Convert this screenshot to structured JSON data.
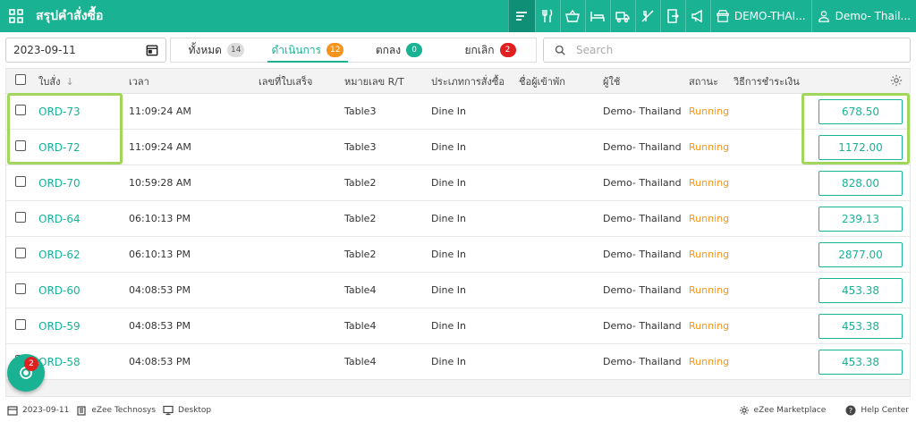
{
  "header": {
    "title": "สรุปคำสั่งซื้อ",
    "outlet": "DEMO-THAI...",
    "user": "Demo- Thail..."
  },
  "filters": {
    "date": "2023-09-11",
    "tabs": [
      {
        "label": "ทั้งหมด",
        "count": "14"
      },
      {
        "label": "ดำเนินการ",
        "count": "12"
      },
      {
        "label": "ตกลง",
        "count": "0"
      },
      {
        "label": "ยกเลิก",
        "count": "2"
      }
    ],
    "search_placeholder": "Search"
  },
  "table": {
    "columns": {
      "order": "ใบสั่ง",
      "time": "เวลา",
      "receipt": "เลขที่ใบเสร็จ",
      "table_no": "หมายเลข R/T",
      "order_type": "ประเภทการสั่งซื้อ",
      "guest": "ชื่อผู้เข้าพัก",
      "user": "ผู้ใช้",
      "status": "สถานะ",
      "payment": "วิธีการชำระเงิน"
    },
    "rows": [
      {
        "order": "ORD-73",
        "time": "11:09:24 AM",
        "table": "Table3",
        "type": "Dine In",
        "user": "Demo- Thailand",
        "status": "Running",
        "amount": "678.50"
      },
      {
        "order": "ORD-72",
        "time": "11:09:24 AM",
        "table": "Table3",
        "type": "Dine In",
        "user": "Demo- Thailand",
        "status": "Running",
        "amount": "1172.00"
      },
      {
        "order": "ORD-70",
        "time": "10:59:28 AM",
        "table": "Table2",
        "type": "Dine In",
        "user": "Demo- Thailand",
        "status": "Running",
        "amount": "828.00"
      },
      {
        "order": "ORD-64",
        "time": "06:10:13 PM",
        "table": "Table2",
        "type": "Dine In",
        "user": "Demo- Thailand",
        "status": "Running",
        "amount": "239.13"
      },
      {
        "order": "ORD-62",
        "time": "06:10:13 PM",
        "table": "Table2",
        "type": "Dine In",
        "user": "Demo- Thailand",
        "status": "Running",
        "amount": "2877.00"
      },
      {
        "order": "ORD-60",
        "time": "04:08:53 PM",
        "table": "Table4",
        "type": "Dine In",
        "user": "Demo- Thailand",
        "status": "Running",
        "amount": "453.38"
      },
      {
        "order": "ORD-59",
        "time": "04:08:53 PM",
        "table": "Table4",
        "type": "Dine In",
        "user": "Demo- Thailand",
        "status": "Running",
        "amount": "453.38"
      },
      {
        "order": "ORD-58",
        "time": "04:08:53 PM",
        "table": "Table4",
        "type": "Dine In",
        "user": "Demo- Thailand",
        "status": "Running",
        "amount": "453.38"
      }
    ]
  },
  "fab": {
    "badge": "2"
  },
  "statusbar": {
    "date": "2023-09-11",
    "company": "eZee Technosys",
    "platform": "Desktop",
    "marketplace": "eZee Marketplace",
    "help": "Help Center"
  },
  "colors": {
    "primary": "#19b394",
    "running": "#f7941d",
    "highlight": "#9fd65b",
    "danger": "#e02020"
  }
}
